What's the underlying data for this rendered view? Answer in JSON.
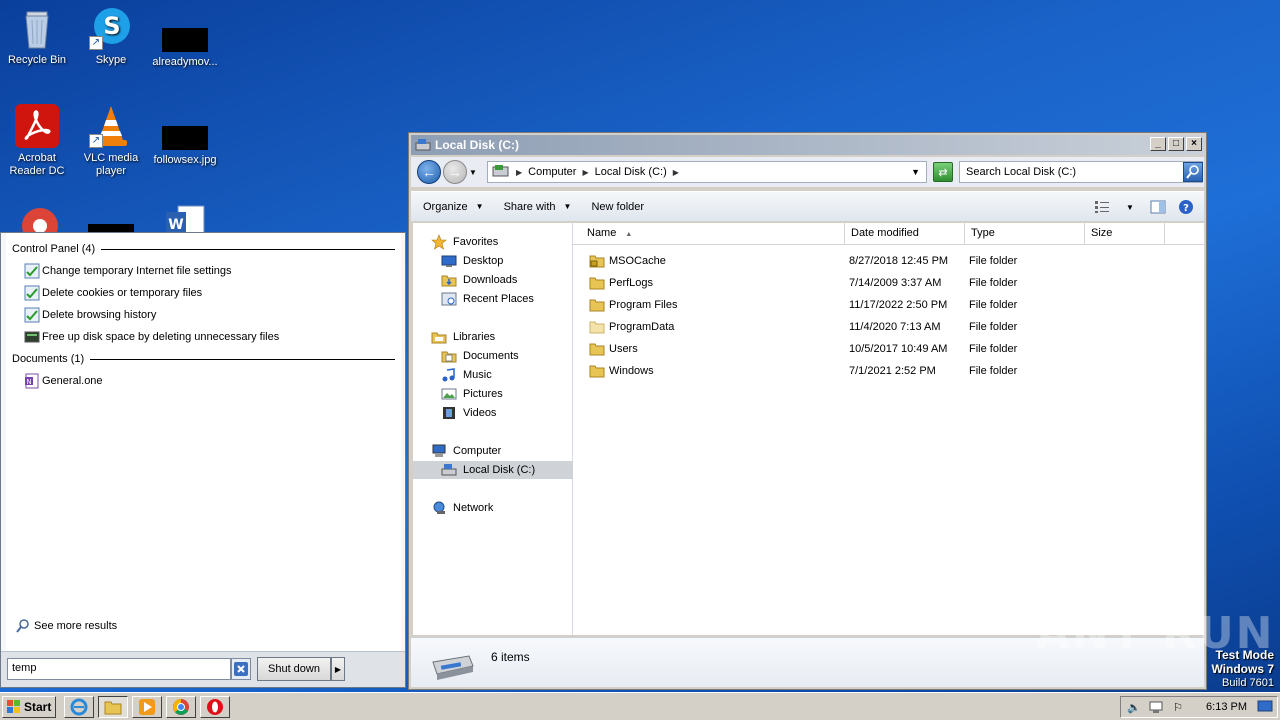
{
  "desktop": {
    "icons": [
      {
        "label": "Recycle Bin"
      },
      {
        "label": "Skype"
      },
      {
        "label": "alreadymov..."
      },
      {
        "label": "Acrobat Reader DC"
      },
      {
        "label": "VLC media player"
      },
      {
        "label": "followsex.jpg"
      }
    ]
  },
  "start_menu": {
    "groups": [
      {
        "header": "Control Panel (4)",
        "items": [
          "Change temporary Internet file settings",
          "Delete cookies or temporary files",
          "Delete browsing history",
          "Free up disk space by deleting unnecessary files"
        ]
      },
      {
        "header": "Documents (1)",
        "items": [
          "General.one"
        ]
      }
    ],
    "see_more": "See more results",
    "search_value": "temp",
    "shutdown_label": "Shut down"
  },
  "explorer": {
    "title": "Local Disk (C:)",
    "breadcrumbs": [
      "Computer",
      "Local Disk (C:)"
    ],
    "search_placeholder": "Search Local Disk (C:)",
    "commands": [
      "Organize",
      "Share with",
      "New folder"
    ],
    "nav": {
      "favorites": "Favorites",
      "favorites_items": [
        "Desktop",
        "Downloads",
        "Recent Places"
      ],
      "libraries": "Libraries",
      "libraries_items": [
        "Documents",
        "Music",
        "Pictures",
        "Videos"
      ],
      "computer": "Computer",
      "computer_items": [
        "Local Disk (C:)"
      ],
      "network": "Network"
    },
    "columns": [
      "Name",
      "Date modified",
      "Type",
      "Size"
    ],
    "files": [
      {
        "name": "MSOCache",
        "date": "8/27/2018 12:45 PM",
        "type": "File folder"
      },
      {
        "name": "PerfLogs",
        "date": "7/14/2009 3:37 AM",
        "type": "File folder"
      },
      {
        "name": "Program Files",
        "date": "11/17/2022 2:50 PM",
        "type": "File folder"
      },
      {
        "name": "ProgramData",
        "date": "11/4/2020 7:13 AM",
        "type": "File folder"
      },
      {
        "name": "Users",
        "date": "10/5/2017 10:49 AM",
        "type": "File folder"
      },
      {
        "name": "Windows",
        "date": "7/1/2021 2:52 PM",
        "type": "File folder"
      }
    ],
    "status": "6 items"
  },
  "watermark": {
    "brand": "ANY RUN",
    "test_mode": "Test Mode",
    "os": "Windows 7",
    "build": "Build 7601"
  },
  "taskbar": {
    "start_label": "Start",
    "clock": "6:13 PM"
  }
}
